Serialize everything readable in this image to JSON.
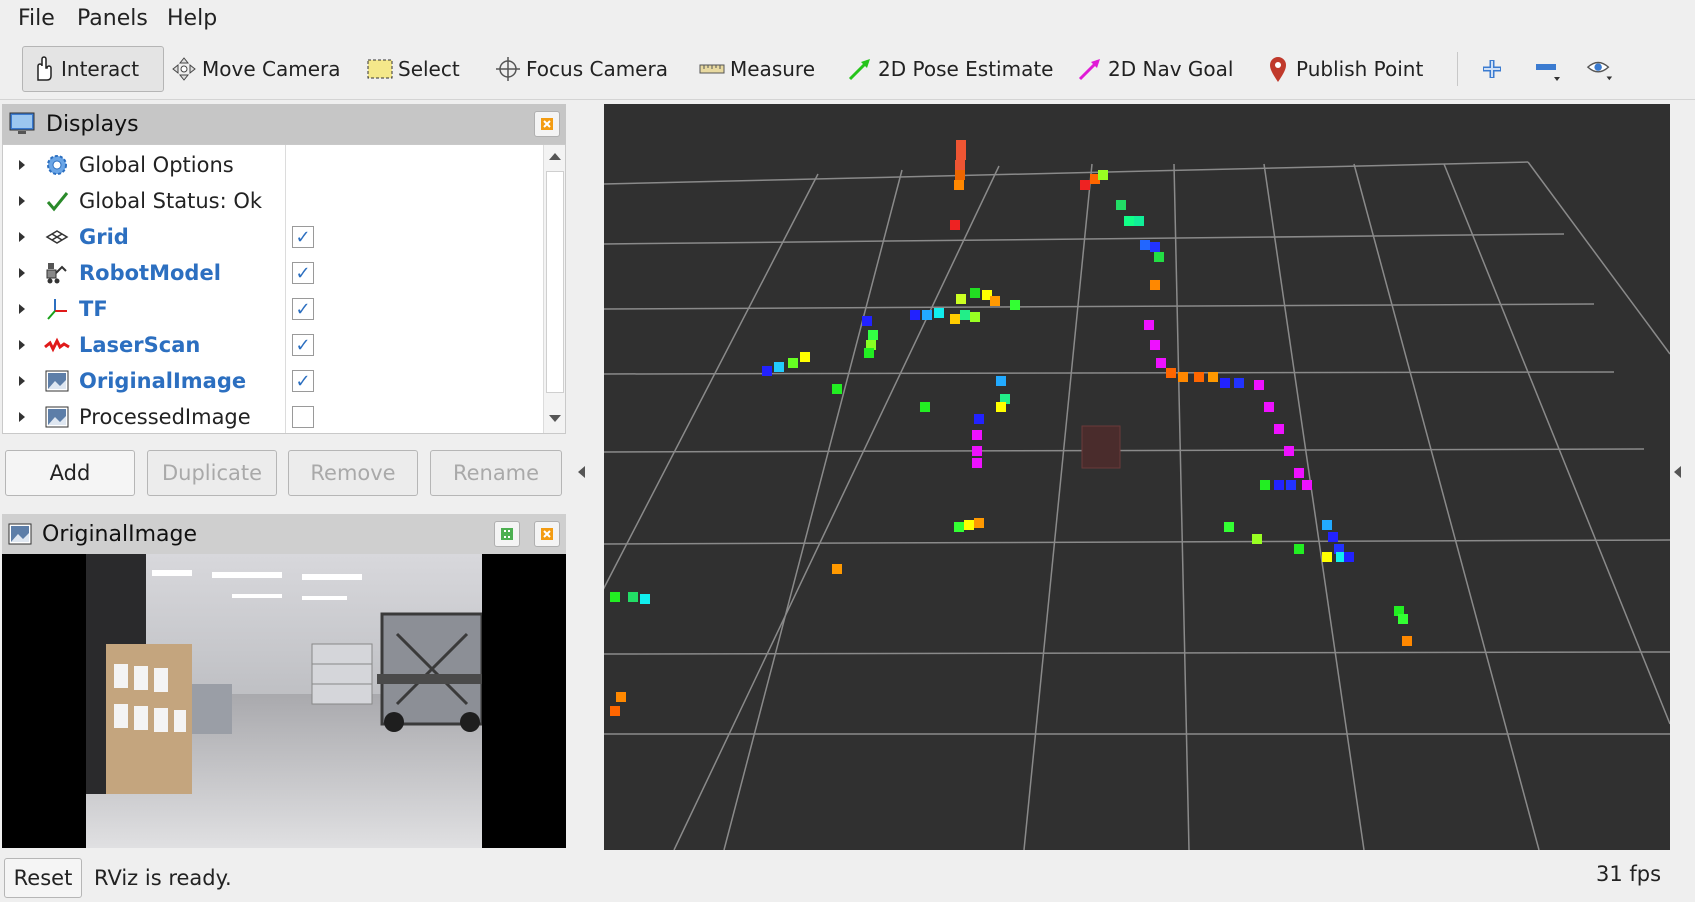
{
  "menu": {
    "items": [
      "File",
      "Panels",
      "Help"
    ]
  },
  "toolbar": {
    "tools": [
      "Interact",
      "Move Camera",
      "Select",
      "Focus Camera",
      "Measure",
      "2D Pose Estimate",
      "2D Nav Goal",
      "Publish Point"
    ]
  },
  "displays": {
    "title": "Displays",
    "items": [
      {
        "label": "Global Options",
        "icon": "gear-icon",
        "checked": null
      },
      {
        "label": "Global Status: Ok",
        "icon": "checkmark-icon",
        "checked": null
      },
      {
        "label": "Grid",
        "icon": "grid-icon",
        "checked": true
      },
      {
        "label": "RobotModel",
        "icon": "robot-icon",
        "checked": true
      },
      {
        "label": "TF",
        "icon": "axes-icon",
        "checked": true
      },
      {
        "label": "LaserScan",
        "icon": "laser-icon",
        "checked": true
      },
      {
        "label": "OriginalImage",
        "icon": "image-icon",
        "checked": true
      },
      {
        "label": "ProcessedImage",
        "icon": "image-icon",
        "checked": false
      }
    ],
    "buttons": {
      "add": "Add",
      "duplicate": "Duplicate",
      "remove": "Remove",
      "rename": "Rename"
    }
  },
  "image_panel": {
    "title": "OriginalImage"
  },
  "status": {
    "reset_label": "Reset",
    "message": "RViz is ready.",
    "fps": "31 fps"
  },
  "colors": {
    "viewport_bg": "#303030",
    "grid_line": "#8a8a8a",
    "accent_blue": "#2c6fc0",
    "panel_title_bg": "#c6c6c6"
  }
}
